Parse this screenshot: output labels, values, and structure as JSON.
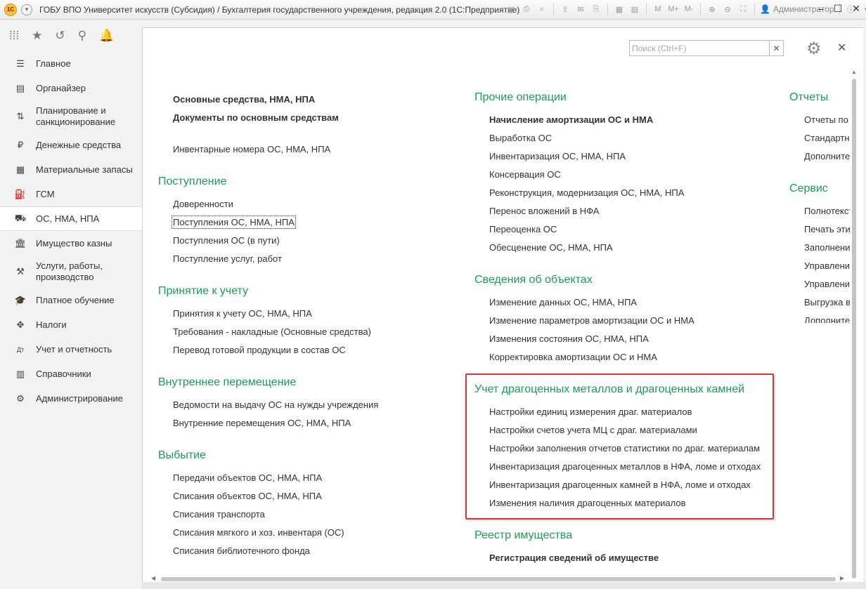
{
  "window": {
    "title": "ГОБУ ВПО Университет искусств (Субсидия) / Бухгалтерия государственного учреждения, редакция 2.0  (1С:Предприятие)",
    "logo_text": "1С",
    "user": "Администратор",
    "memory_buttons": [
      "M",
      "M+",
      "M-"
    ]
  },
  "sidebar": {
    "items": [
      {
        "label": "Главное",
        "icon": "menu-lines-icon",
        "glyph": "☰"
      },
      {
        "label": "Органайзер",
        "icon": "organizer-icon",
        "glyph": "▤"
      },
      {
        "label": "Планирование и санкционирование",
        "icon": "planning-icon",
        "glyph": "⇅"
      },
      {
        "label": "Денежные средства",
        "icon": "ruble-icon",
        "glyph": "₽"
      },
      {
        "label": "Материальные запасы",
        "icon": "grid-icon",
        "glyph": "▦"
      },
      {
        "label": "ГСМ",
        "icon": "fuel-icon",
        "glyph": "⛽"
      },
      {
        "label": "ОС, НМА, НПА",
        "icon": "truck-icon",
        "glyph": "⛟"
      },
      {
        "label": "Имущество казны",
        "icon": "building-icon",
        "glyph": "🏛"
      },
      {
        "label": "Услуги, работы, производство",
        "icon": "tools-icon",
        "glyph": "⚒"
      },
      {
        "label": "Платное обучение",
        "icon": "graduation-cap-icon",
        "glyph": "🎓"
      },
      {
        "label": "Налоги",
        "icon": "emblem-icon",
        "glyph": "✥"
      },
      {
        "label": "Учет и отчетность",
        "icon": "accounting-icon",
        "glyph": "Дт"
      },
      {
        "label": "Справочники",
        "icon": "books-icon",
        "glyph": "▥"
      },
      {
        "label": "Администрирование",
        "icon": "gear-icon",
        "glyph": "⚙"
      }
    ]
  },
  "search": {
    "placeholder": "Поиск (Ctrl+F)"
  },
  "col1": {
    "top": [
      {
        "label": "Основные средства, НМА, НПА",
        "bold": true
      },
      {
        "label": "Документы по основным средствам",
        "bold": true
      },
      {
        "label": "Инвентарные номера ОС, НМА, НПА",
        "bold": false
      }
    ],
    "postuplenie": {
      "title": "Поступление",
      "items": [
        "Доверенности",
        "Поступления ОС, НМА, НПА",
        "Поступления ОС (в пути)",
        "Поступление услуг, работ"
      ]
    },
    "prinyatie": {
      "title": "Принятие к учету",
      "items": [
        "Принятия к учету ОС, НМА, НПА",
        "Требования - накладные (Основные средства)",
        "Перевод готовой продукции в состав ОС"
      ]
    },
    "peremeschenie": {
      "title": "Внутреннее перемещение",
      "items": [
        "Ведомости на выдачу ОС на нужды учреждения",
        "Внутренние перемещения ОС, НМА, НПА"
      ]
    },
    "vybytie": {
      "title": "Выбытие",
      "items": [
        "Передачи объектов ОС, НМА, НПА",
        "Списания объектов ОС, НМА, НПА",
        "Списания транспорта",
        "Списания мягкого и хоз. инвентаря (ОС)",
        "Списания библиотечного фонда"
      ]
    }
  },
  "col2": {
    "prochie": {
      "title": "Прочие операции",
      "items": [
        "Начисление амортизации ОС и НМА",
        "Выработка ОС",
        "Инвентаризация ОС, НМА, НПА",
        "Консервация ОС",
        "Реконструкция, модернизация ОС, НМА, НПА",
        "Перенос вложений в НФА",
        "Переоценка ОС",
        "Обесценение ОС, НМА, НПА"
      ]
    },
    "svedeniya": {
      "title": "Сведения об объектах",
      "items": [
        "Изменение данных ОС, НМА, НПА",
        "Изменение параметров амортизации ОС и НМА",
        "Изменения состояния ОС, НМА, НПА",
        "Корректировка амортизации ОС и НМА"
      ]
    },
    "dragmet": {
      "title": "Учет драгоценных металлов и драгоценных камней",
      "items": [
        "Настройки единиц измерения драг. материалов",
        "Настройки счетов учета МЦ с драг. материалами",
        "Настройки заполнения отчетов статистики по драг. материалам",
        "Инвентаризация драгоценных металлов в НФА, ломе и отходах",
        "Инвентаризация драгоценных камней в НФА, ломе и отходах",
        "Изменения наличия драгоценных материалов"
      ]
    },
    "reestr": {
      "title": "Реестр имущества",
      "items": [
        "Регистрация сведений об имуществе"
      ]
    }
  },
  "col3": {
    "otchety": {
      "title": "Отчеты",
      "items": [
        "Отчеты по",
        "Стандартн",
        "Дополните"
      ]
    },
    "servis": {
      "title": "Сервис",
      "items": [
        "Полнотекст",
        "Печать эти",
        "Заполнение",
        "Управление",
        "Управление",
        "Выгрузка в",
        "Дополните"
      ]
    }
  }
}
